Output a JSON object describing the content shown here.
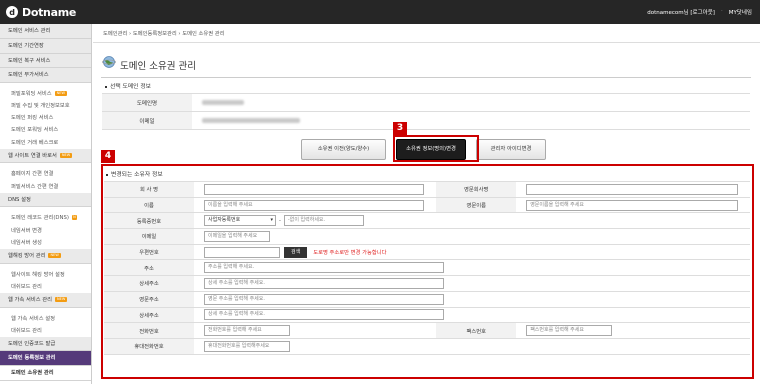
{
  "header": {
    "logo": "Dotname",
    "user_text": "dotnamecom님 [로그아웃]",
    "my_link": "MY닷네임"
  },
  "sidebar": {
    "items": [
      {
        "label": "도메인 서비스 관리",
        "type": "top"
      },
      {
        "label": "도메인 기간연장",
        "type": "top"
      },
      {
        "label": "도메인 복구 서비스",
        "type": "top"
      },
      {
        "label": "도메인 부가서비스",
        "type": "top"
      },
      {
        "label": "",
        "type": "gap"
      },
      {
        "label": "퍼밀포워딩 서비스",
        "type": "sub",
        "badge": "NEW"
      },
      {
        "label": "퍼밀 수집 및 개인정보보호",
        "type": "sub"
      },
      {
        "label": "도메인 퍼킹 서비스",
        "type": "sub"
      },
      {
        "label": "도메인 포워딩 서비스",
        "type": "sub"
      },
      {
        "label": "도메인 거래 베스크로",
        "type": "sub"
      },
      {
        "label": "웹 사이트 연결 바로서",
        "type": "top",
        "badge": "NEW"
      },
      {
        "label": "",
        "type": "gap"
      },
      {
        "label": "홈페이지 간편 연결",
        "type": "sub"
      },
      {
        "label": "퍼밀서비스 간편 연결",
        "type": "sub"
      },
      {
        "label": "DNS 설정",
        "type": "top"
      },
      {
        "label": "",
        "type": "gap"
      },
      {
        "label": "도메인 레코드 관리(DNS)",
        "type": "sub",
        "badge": "N"
      },
      {
        "label": "네임서버 변경",
        "type": "sub"
      },
      {
        "label": "네임서버 생성",
        "type": "sub"
      },
      {
        "label": "웹해킹 방어 관리",
        "type": "top",
        "badge": "NEW"
      },
      {
        "label": "",
        "type": "gap"
      },
      {
        "label": "웹사이트 해킹 방어 설정",
        "type": "sub"
      },
      {
        "label": "대쉬보드 관리",
        "type": "sub"
      },
      {
        "label": "웹 가속 서비스 관리",
        "type": "top",
        "badge": "NEW"
      },
      {
        "label": "",
        "type": "gap"
      },
      {
        "label": "웹 가속 서비스 설정",
        "type": "sub"
      },
      {
        "label": "대쉬보드 관리",
        "type": "sub"
      },
      {
        "label": "도메인 인증코드 발급",
        "type": "top"
      },
      {
        "label": "도메인 등록정보 관리",
        "type": "active"
      },
      {
        "label": "도메인 소유권 관리",
        "type": "activesub"
      }
    ]
  },
  "breadcrumb": "도메인관리 › 도메인등록정보관리 › 도메인 소유권 관리",
  "page_title": "도메인 소유권 관리",
  "selected_section": {
    "title": "선택 도메인 정보",
    "rows": [
      {
        "label": "도메인명"
      },
      {
        "label": "이메일"
      }
    ]
  },
  "buttons": {
    "transfer": "소유권 이전(양도/양수)",
    "change_info": "소유권 정보(명의)변경",
    "admin_id_change": "관리자 아이디변경"
  },
  "tags": {
    "three": "3",
    "four": "4"
  },
  "change_section": {
    "title": "변경되는 소유자 정보",
    "company_label": "회 사 명",
    "company_en_label": "영문회사명",
    "name_label": "이름",
    "name_placeholder": "이름을 입력해 주세요",
    "name_en_label": "영문이름",
    "name_en_placeholder": "영문이름을 입력해 주세요",
    "reg_label": "등록증번호",
    "reg_select": "사업자등록번호",
    "reg_placeholder": "-없이 입력하세요.",
    "email_label": "이메일",
    "email_placeholder": "이메일을 입력해 주세요",
    "zip_label": "우편번호",
    "zip_button": "검색",
    "zip_warning": "도로명 주소로만 변경 가능합니다",
    "addr_label": "주소",
    "addr_placeholder": "주소를 입력해 주세요.",
    "addr_detail_label": "상세주소",
    "addr_detail_placeholder": "상세 주소를 입력해 주세요.",
    "addr_en_label": "영문주소",
    "addr_en_placeholder": "영문 주소를 입력해 주세요.",
    "addr_en_detail_label": "상세주소",
    "addr_en_detail_placeholder": "상세 주소를 입력해 주세요.",
    "phone_label": "전화번호",
    "phone_placeholder": "전화번호를 입력해 주세요",
    "fax_label": "팩스번호",
    "fax_placeholder": "팩스번호를 입력해 주세요",
    "mobile_label": "휴대전화번호",
    "mobile_placeholder": "휴대전화번호를 입력해주세요"
  },
  "colors": {
    "topbar": "#262626",
    "highlight": "#cc0000",
    "sidebar_active": "#553a7a"
  }
}
